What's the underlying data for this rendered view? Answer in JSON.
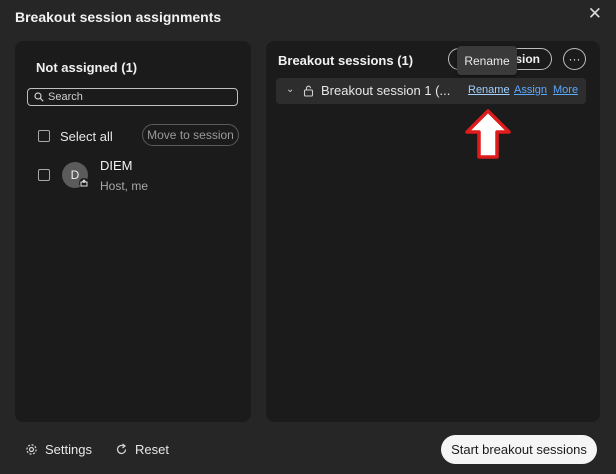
{
  "window": {
    "title": "Breakout session assignments",
    "close_glyph": "✕"
  },
  "left_panel": {
    "heading": "Not assigned (1)",
    "search_placeholder": "Search",
    "select_all_label": "Select all",
    "move_button_label": "Move to session",
    "participants": [
      {
        "initial": "D",
        "name": "DIEM",
        "role": "Host, me"
      }
    ]
  },
  "right_panel": {
    "heading": "Breakout sessions  (1)",
    "add_button_label": "ssion",
    "more_button_glyph": "···",
    "tooltip": "Rename",
    "sessions": [
      {
        "name": "Breakout session 1 (...",
        "links": {
          "rename": "Rename",
          "assign": "Assign",
          "more": "More"
        }
      }
    ]
  },
  "footer": {
    "settings_label": "Settings",
    "reset_label": "Reset",
    "start_button_label": "Start breakout sessions"
  },
  "colors": {
    "background": "#262626",
    "panel": "#1b1b1b",
    "link": "#5aa8ff",
    "arrow": "#e01b1b"
  }
}
